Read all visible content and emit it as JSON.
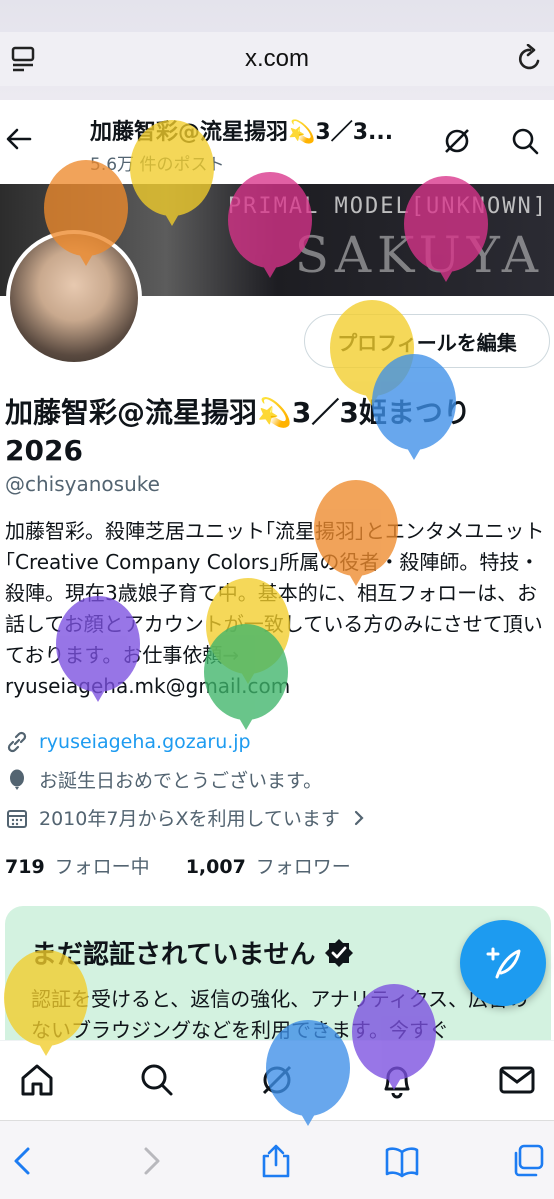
{
  "browser": {
    "url": "x.com"
  },
  "header": {
    "title": "加藤智彩@流星揚羽💫3／3...",
    "post_count": "5.6万 件のポスト"
  },
  "banner": {
    "small_text": "PRIMAL MODEL[UNKNOWN]",
    "big_text": "SAKUYA"
  },
  "profile": {
    "edit_button": "プロフィールを編集",
    "name_line1": "加藤智彩@流星揚羽💫3／3姫まつり",
    "name_line2": "2026",
    "handle": "@chisyanosuke",
    "bio": "加藤智彩。殺陣芝居ユニット｢流星揚羽｣とエンタメユニット｢Creative Company Colors｣所属の役者・殺陣師。特技・殺陣。現在3歳娘子育て中。基本的に、相互フォローは、お話してお顔とアカウントが一致している方のみにさせて頂いております。お仕事依頼→\nryuseiageha.mk@gmail.com",
    "website": "ryuseiageha.gozaru.jp",
    "birthday": "お誕生日おめでとうございます。",
    "joined": "2010年7月からXを利用しています",
    "following_count": "719",
    "following_label": "フォロー中",
    "followers_count": "1,007",
    "followers_label": "フォロワー"
  },
  "verify_card": {
    "title": "まだ認証されていません",
    "body": "認証を受けると、返信の強化、アナリティクス、広告のないブラウジングなどを利用できます。今すぐ"
  },
  "colors": {
    "accent": "#1d9bf0",
    "card_bg": "#d3f2e0",
    "text_primary": "#0f1419",
    "text_secondary": "#536471"
  },
  "icons": {
    "nav": [
      "home-icon",
      "search-icon",
      "grok-icon",
      "notifications-icon",
      "messages-icon"
    ],
    "safari": [
      "back-icon",
      "forward-icon",
      "share-icon",
      "bookmarks-icon",
      "tabs-icon"
    ]
  }
}
